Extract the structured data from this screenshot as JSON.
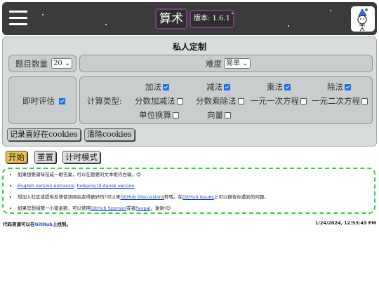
{
  "header": {
    "title": "算术",
    "version": "版本: 1.6.1"
  },
  "settings": {
    "title": "私人定制",
    "question_count_label": "题目数量",
    "question_count_value": "20",
    "difficulty_label": "难度",
    "difficulty_value": "简单",
    "instant_eval_label": "即时评估",
    "calc_types_label": "计算类型:",
    "ops": [
      {
        "label": "加法",
        "checked": true
      },
      {
        "label": "减法",
        "checked": true
      },
      {
        "label": "乘法",
        "checked": true
      },
      {
        "label": "除法",
        "checked": true
      }
    ],
    "types": [
      {
        "label": "分数加减法",
        "checked": false
      },
      {
        "label": "分数乘除法",
        "checked": false
      },
      {
        "label": "一元一次方程",
        "checked": false
      },
      {
        "label": "一元二次方程",
        "checked": false
      },
      {
        "label": "单位换算",
        "checked": false
      },
      {
        "label": "向量",
        "checked": false
      }
    ],
    "save_cookies": "记录喜好在cookies",
    "clear_cookies": "清除cookies"
  },
  "actions": {
    "start": "开始",
    "reset": "重置",
    "timer_mode": "计时模式"
  },
  "info": {
    "line1": "如果想要调味祛咸一眼答案，可以在题要的文本框内右输。😊",
    "english_link": "English version entrance",
    "danish_link": "Indgang til dansk version",
    "line3_pre": "想加入社区或提供反馈使该网站变得更好吗?可以来",
    "discussions_link": "GitHub Discussions",
    "line3_mid": "转转。在",
    "issues_link": "GitHub Issues",
    "line3_post": "上可以报告你遇到的问题。",
    "line4_pre": "如果您想捐赠一小笔金额，可以使用",
    "sponsor_link": "GitHub Sponsor",
    "line4_mid": "或者",
    "paypal_link": "Paypal",
    "line4_post": "，谢谢!😊"
  },
  "footer": {
    "source_pre": "代码资源可以在",
    "github_link": "GitHub",
    "source_post": "上找到。",
    "datetime": "1/24/2024, 12:53:43 PM"
  },
  "colors": {
    "header_bg": "#3b3b3b",
    "title_border": "#7a3d7d",
    "panel_bg": "#d9dcdc",
    "info_border": "#31d23a",
    "link": "#1a3fc4"
  }
}
